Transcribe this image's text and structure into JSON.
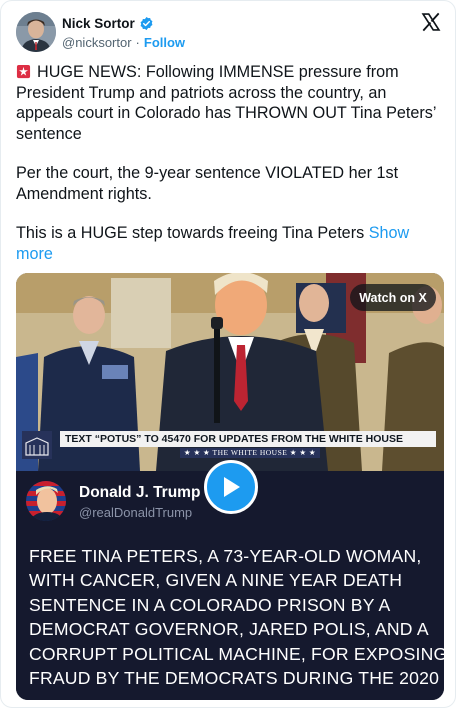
{
  "author": {
    "name": "Nick Sortor",
    "handle": "@nicksortor",
    "separator": "·",
    "follow_label": "Follow"
  },
  "tweet": {
    "para1": "HUGE NEWS: Following IMMENSE pressure from President Trump and patriots across the country, an appeals court in Colorado has THROWN OUT Tina Peters’ sentence",
    "para2": "Per the court, the 9-year sentence VIOLATED her 1st Amendment rights.",
    "para3": "This is a HUGE step towards freeing Tina Peters",
    "show_more": "Show more"
  },
  "media": {
    "watch_label": "Watch on X",
    "chyron_text": "TEXT “POTUS” TO 45470 FOR UPDATES FROM THE WHITE HOUSE",
    "chyron_sub": "★ ★ ★ THE WHITE HOUSE ★ ★ ★",
    "embedded_post": {
      "name": "Donald J. Trump",
      "handle": "@realDonaldTrump",
      "text": "FREE TINA PETERS, A 73-YEAR-OLD WOMAN,\nWITH CANCER, GIVEN A NINE YEAR DEATH\nSENTENCE IN A COLORADO PRISON BY A\nDEMOCRAT GOVERNOR, JARED POLIS, AND A\nCORRUPT POLITICAL MACHINE, FOR EXPOSING\nFRAUD BY THE DEMOCRATS DURING THE 2020"
    }
  },
  "icons": {
    "verified": "verified-badge-icon",
    "x_logo": "x-logo-icon",
    "siren": "siren-emoji-icon",
    "play": "play-icon"
  },
  "colors": {
    "accent": "#1d9bf0",
    "text": "#0f1419",
    "muted": "#536471",
    "post_bg": "#15192e"
  }
}
